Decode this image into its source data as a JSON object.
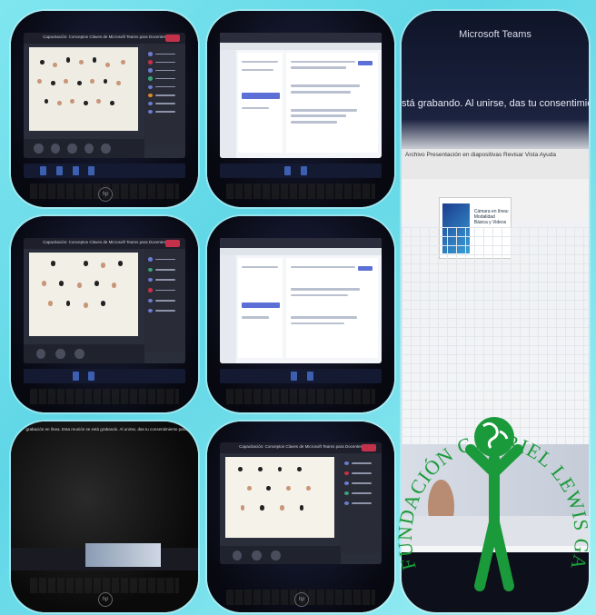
{
  "collage": {
    "meeting_title": "Capacitación: Conceptos Claves de Microsoft Teams para Docentes",
    "teams_title": "Microsoft Teams",
    "consent_banner": "stá grabando. Al unirse, das tu consentimiento para q",
    "ribbon_menu": "Archivo  Presentación en diapositivas  Revisar  Vista  Ayuda",
    "slide_text": "Cámara en línea: Modalidad Básica y Videos",
    "bottom_banner": "grabación en línea. Esta reunión se está grabando. Al unirse, das tu consentimiento para que se grabe. Política de privacidad",
    "hp_logo": "hp",
    "foundation": {
      "name": "FUNDACIÓN GABRIEL LEWIS GALINDO",
      "color": "#1a9a3a"
    }
  }
}
